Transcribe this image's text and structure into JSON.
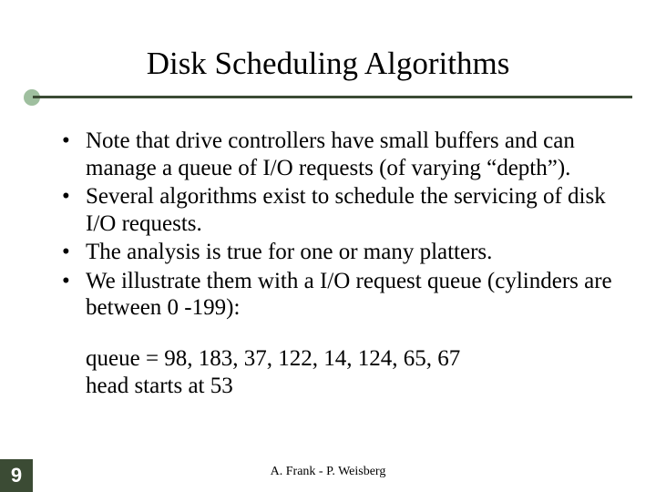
{
  "title": "Disk Scheduling Algorithms",
  "bullets": [
    "Note that drive controllers have small buffers and can manage a queue of I/O requests (of varying “depth”).",
    "Several algorithms exist to schedule the servicing of disk I/O requests.",
    "The analysis is true for one or many platters.",
    "We illustrate them with a I/O request queue (cylinders are between 0 -199):"
  ],
  "queue_line": "queue = 98, 183, 37, 122, 14, 124, 65, 67",
  "head_line": "head starts at 53",
  "author": "A. Frank - P. Weisberg",
  "slide_number": "9"
}
